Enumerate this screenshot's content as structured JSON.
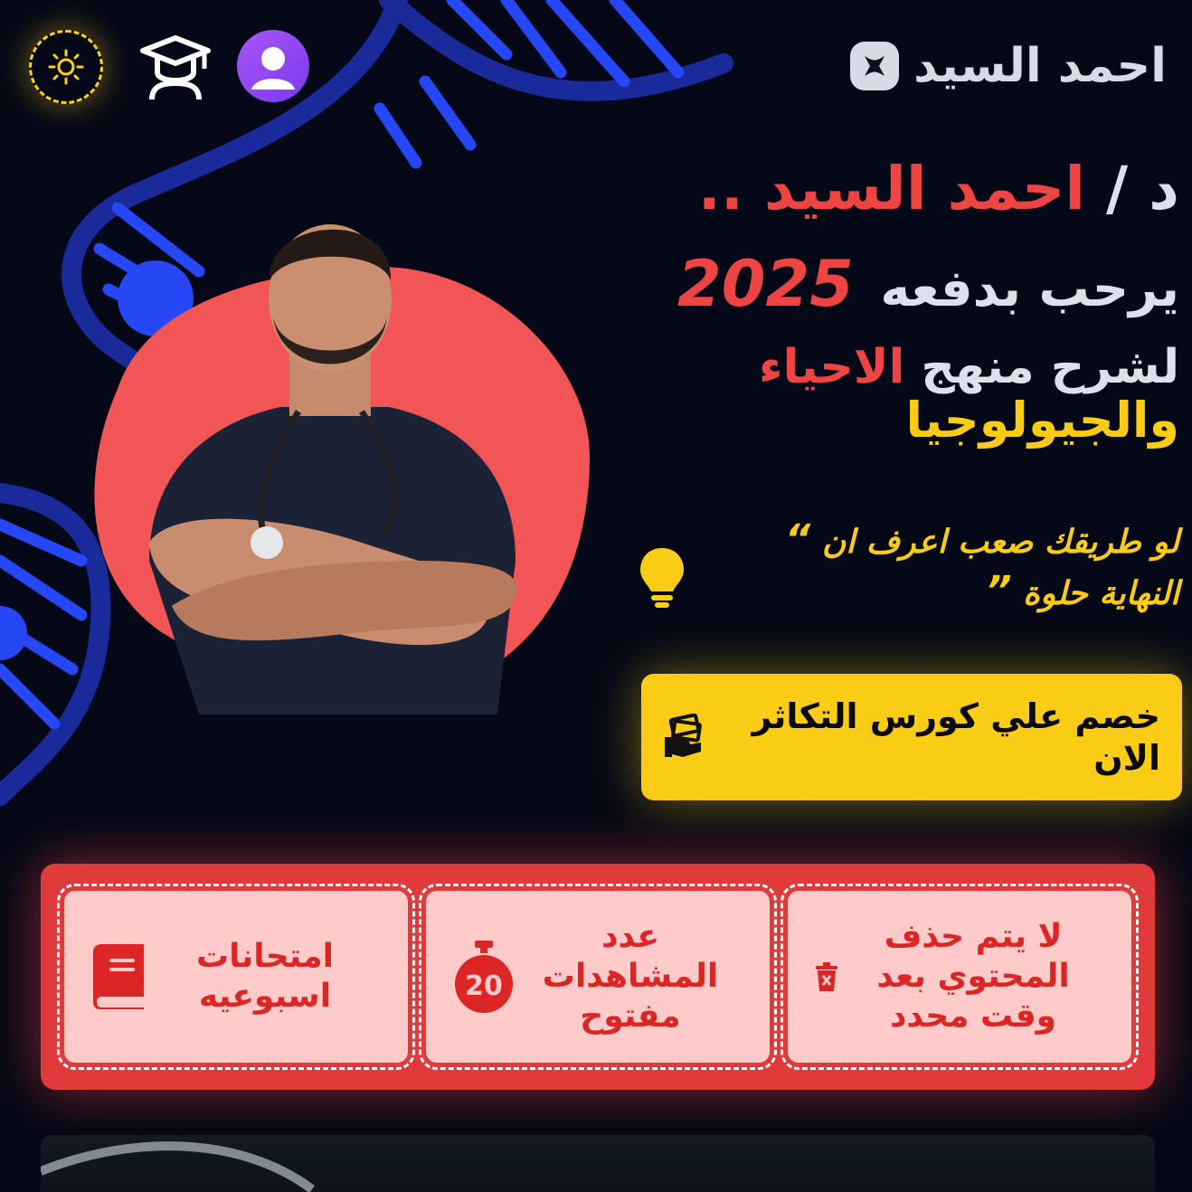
{
  "header": {
    "logo_text": "احمد السيد",
    "theme_toggle_icon": "sun-icon",
    "courses_icon": "graduation-cap-icon",
    "profile_icon": "user-icon"
  },
  "hero": {
    "prefix": "د /",
    "name": "احمد السيد ..",
    "welcome": "يرحب بدفعه",
    "year": "2025",
    "line3_start": "لشرح منهج",
    "subject_bio": "الاحياء",
    "subject_geo": "والجيولوجيا",
    "quote_line1": "لو طريقك صعب اعرف ان",
    "quote_line2": "النهاية حلوة",
    "quote_open": "“",
    "quote_close": "”"
  },
  "cta": {
    "label": "خصم علي كورس التكاثر الان",
    "icon": "money-hand-icon"
  },
  "features": [
    {
      "label": "لا يتم حذف المحتوي بعد وقت محدد",
      "icon": "trash-icon"
    },
    {
      "label": "عدد المشاهدات مفتوح",
      "icon": "stopwatch-icon",
      "badge": "20"
    },
    {
      "label": "امتحانات اسبوعيه",
      "icon": "book-icon"
    }
  ],
  "colors": {
    "background": "#050816",
    "accent_red": "#ef4444",
    "accent_yellow": "#facc15",
    "dna_blue": "#2547f5"
  }
}
